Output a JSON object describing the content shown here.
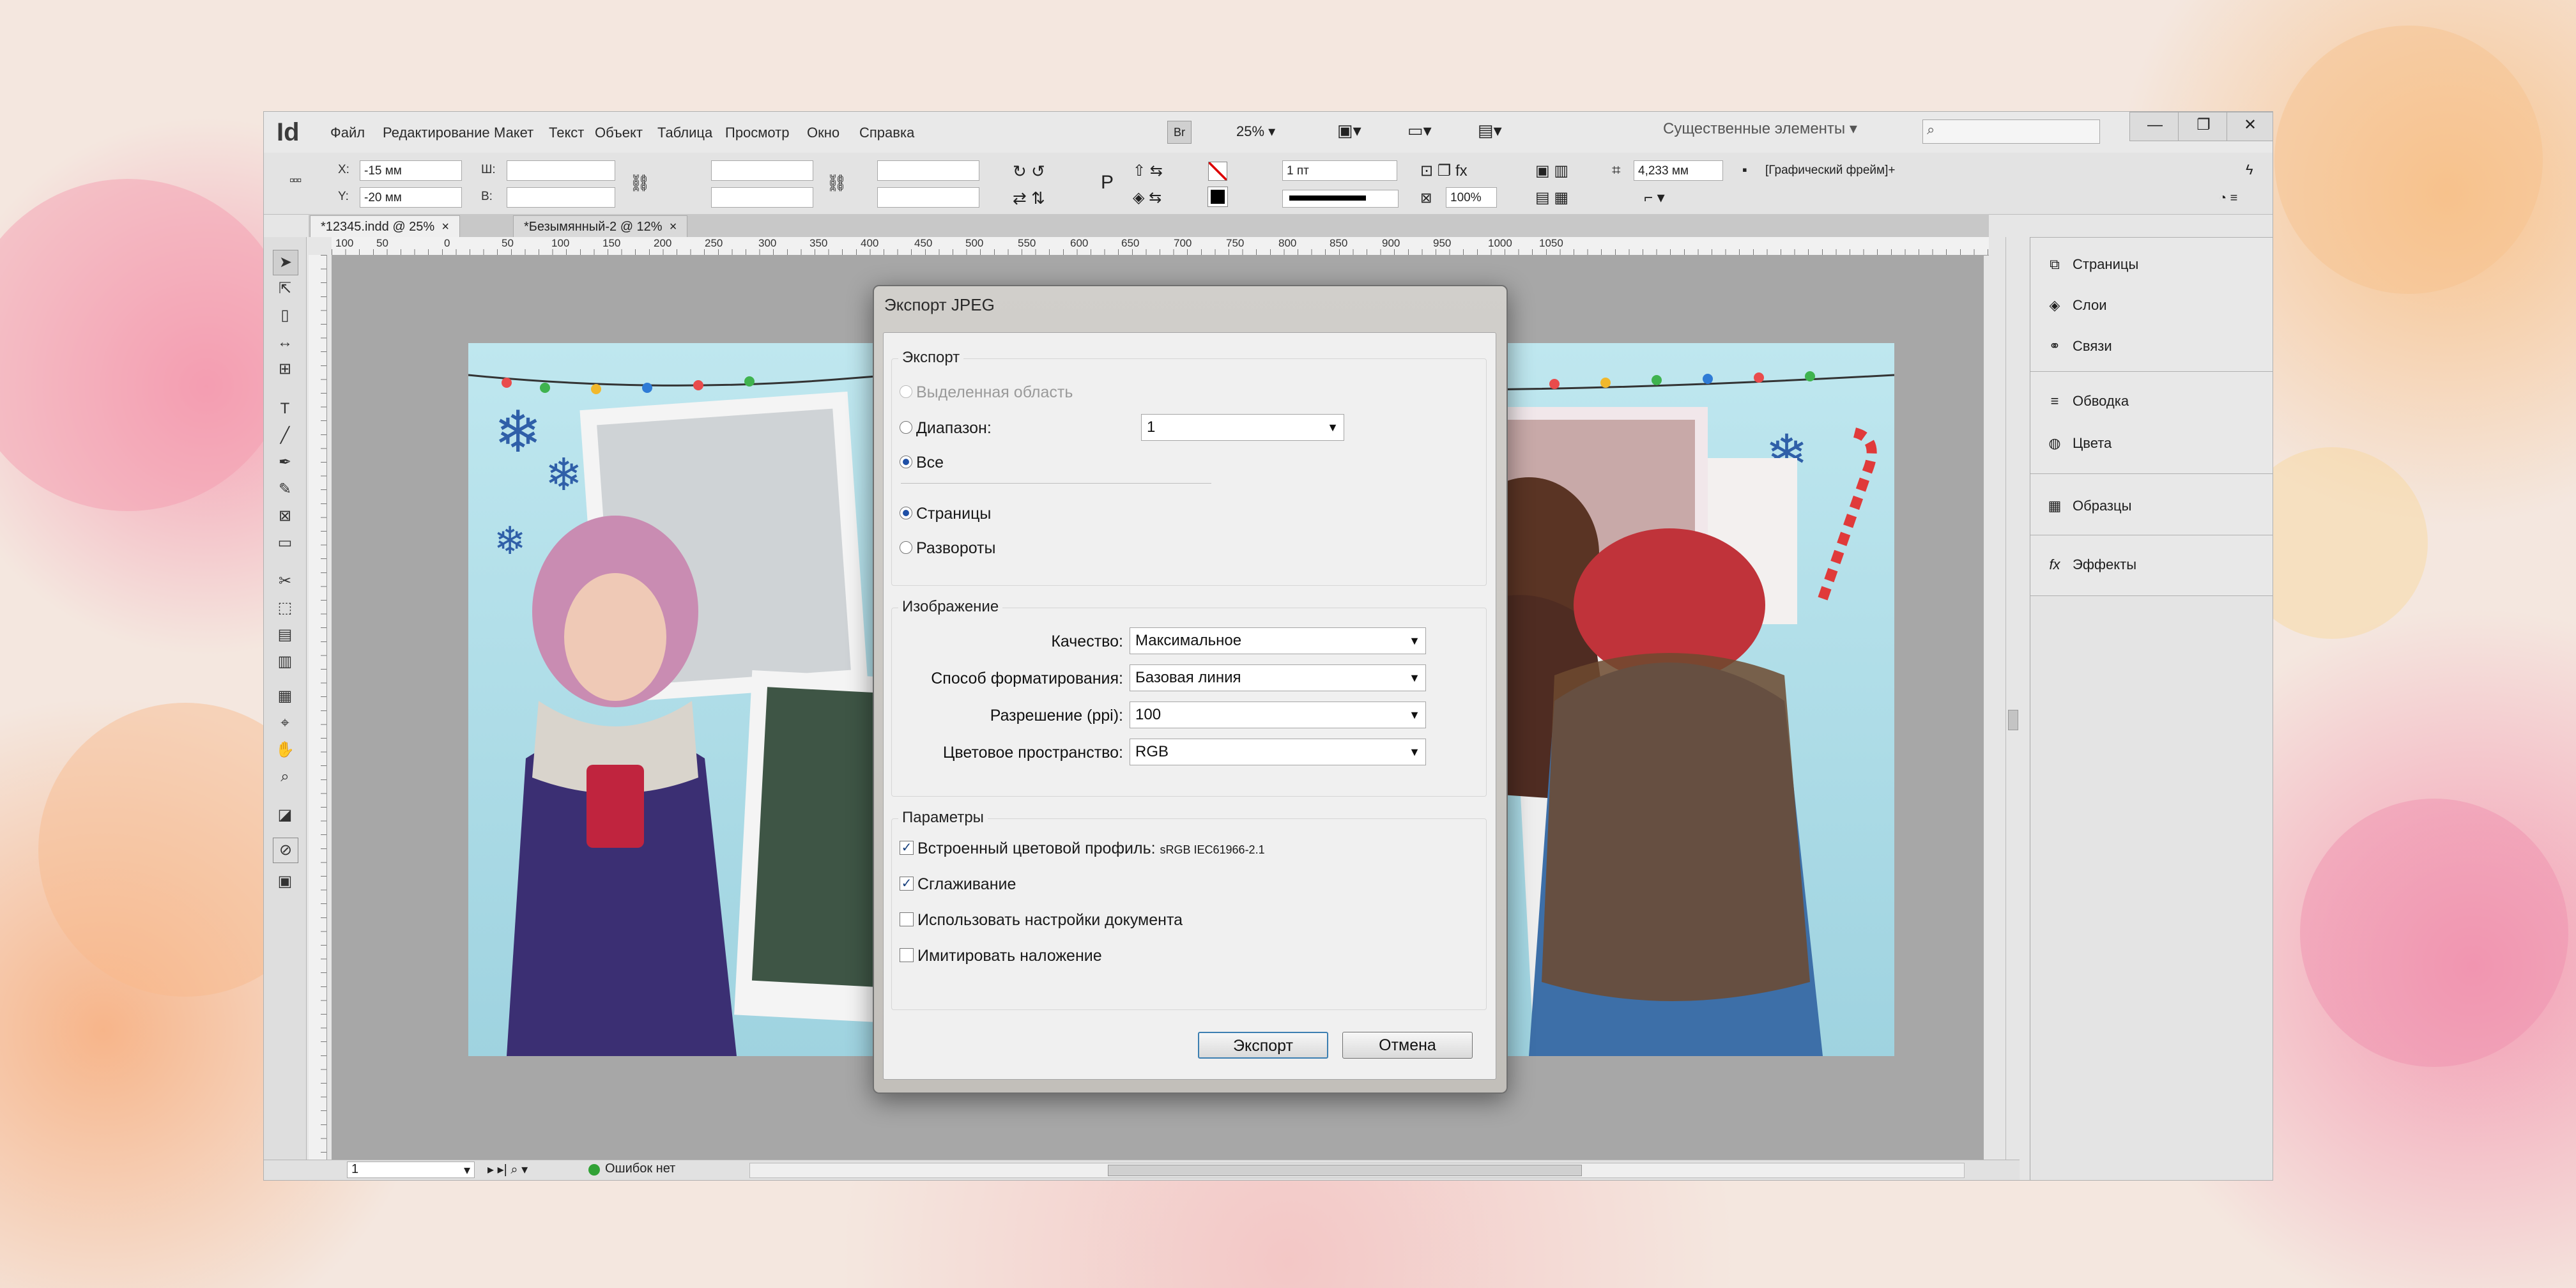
{
  "app": {
    "logo": "Id",
    "menu": [
      "Файл",
      "Редактирование",
      "Макет",
      "Текст",
      "Объект",
      "Таблица",
      "Просмотр",
      "Окно",
      "Справка"
    ],
    "zoom": "25%",
    "workspace": "Существенные элементы",
    "window_buttons": [
      "—",
      "❐",
      "✕"
    ]
  },
  "control": {
    "x_label": "X:",
    "x_value": "-15 мм",
    "y_label": "Y:",
    "y_value": "-20 мм",
    "w_label": "Ш:",
    "h_label": "В:",
    "stroke_weight": "1 пт",
    "opacity": "100%",
    "width_value": "4,233 мм",
    "object_style": "[Графический фрейм]+"
  },
  "tabs": [
    {
      "label": "*12345.indd @ 25%",
      "close": "×"
    },
    {
      "label": "*Безымянный-2 @ 12%",
      "close": "×"
    }
  ],
  "ruler": {
    "ticks": [
      "100",
      "50",
      "0",
      "50",
      "100",
      "150",
      "200",
      "250",
      "300",
      "350",
      "400",
      "450",
      "500",
      "550",
      "600",
      "650",
      "700",
      "750",
      "800",
      "850",
      "900",
      "950",
      "1000",
      "1050"
    ]
  },
  "status": {
    "page": "1",
    "errors": "Ошибок нет"
  },
  "panels": [
    {
      "label": "Страницы",
      "icon": "pages-icon"
    },
    {
      "label": "Слои",
      "icon": "layers-icon"
    },
    {
      "label": "Связи",
      "icon": "links-icon"
    },
    {
      "label": "Обводка",
      "icon": "stroke-icon"
    },
    {
      "label": "Цвета",
      "icon": "color-icon"
    },
    {
      "label": "Образцы",
      "icon": "swatches-icon"
    },
    {
      "label": "Эффекты",
      "icon": "effects-icon"
    }
  ],
  "dialog": {
    "title": "Экспорт JPEG",
    "export_group": "Экспорт",
    "opt_selection": "Выделенная область",
    "opt_range": "Диапазон:",
    "range_value": "1",
    "opt_all": "Все",
    "opt_pages": "Страницы",
    "opt_spreads": "Развороты",
    "image_group": "Изображение",
    "quality_label": "Качество:",
    "quality_value": "Максимальное",
    "format_label": "Способ форматирования:",
    "format_value": "Базовая линия",
    "resolution_label": "Разрешение (ppi):",
    "resolution_value": "100",
    "colorspace_label": "Цветовое пространство:",
    "colorspace_value": "RGB",
    "params_group": "Параметры",
    "embed_profile": "Встроенный цветовой профиль:",
    "embed_profile_value": "sRGB IEC61966-2.1",
    "antialias": "Сглаживание",
    "use_doc_settings": "Использовать настройки документа",
    "simulate_overprint": "Имитировать наложение",
    "export_button": "Экспорт",
    "cancel_button": "Отмена"
  }
}
